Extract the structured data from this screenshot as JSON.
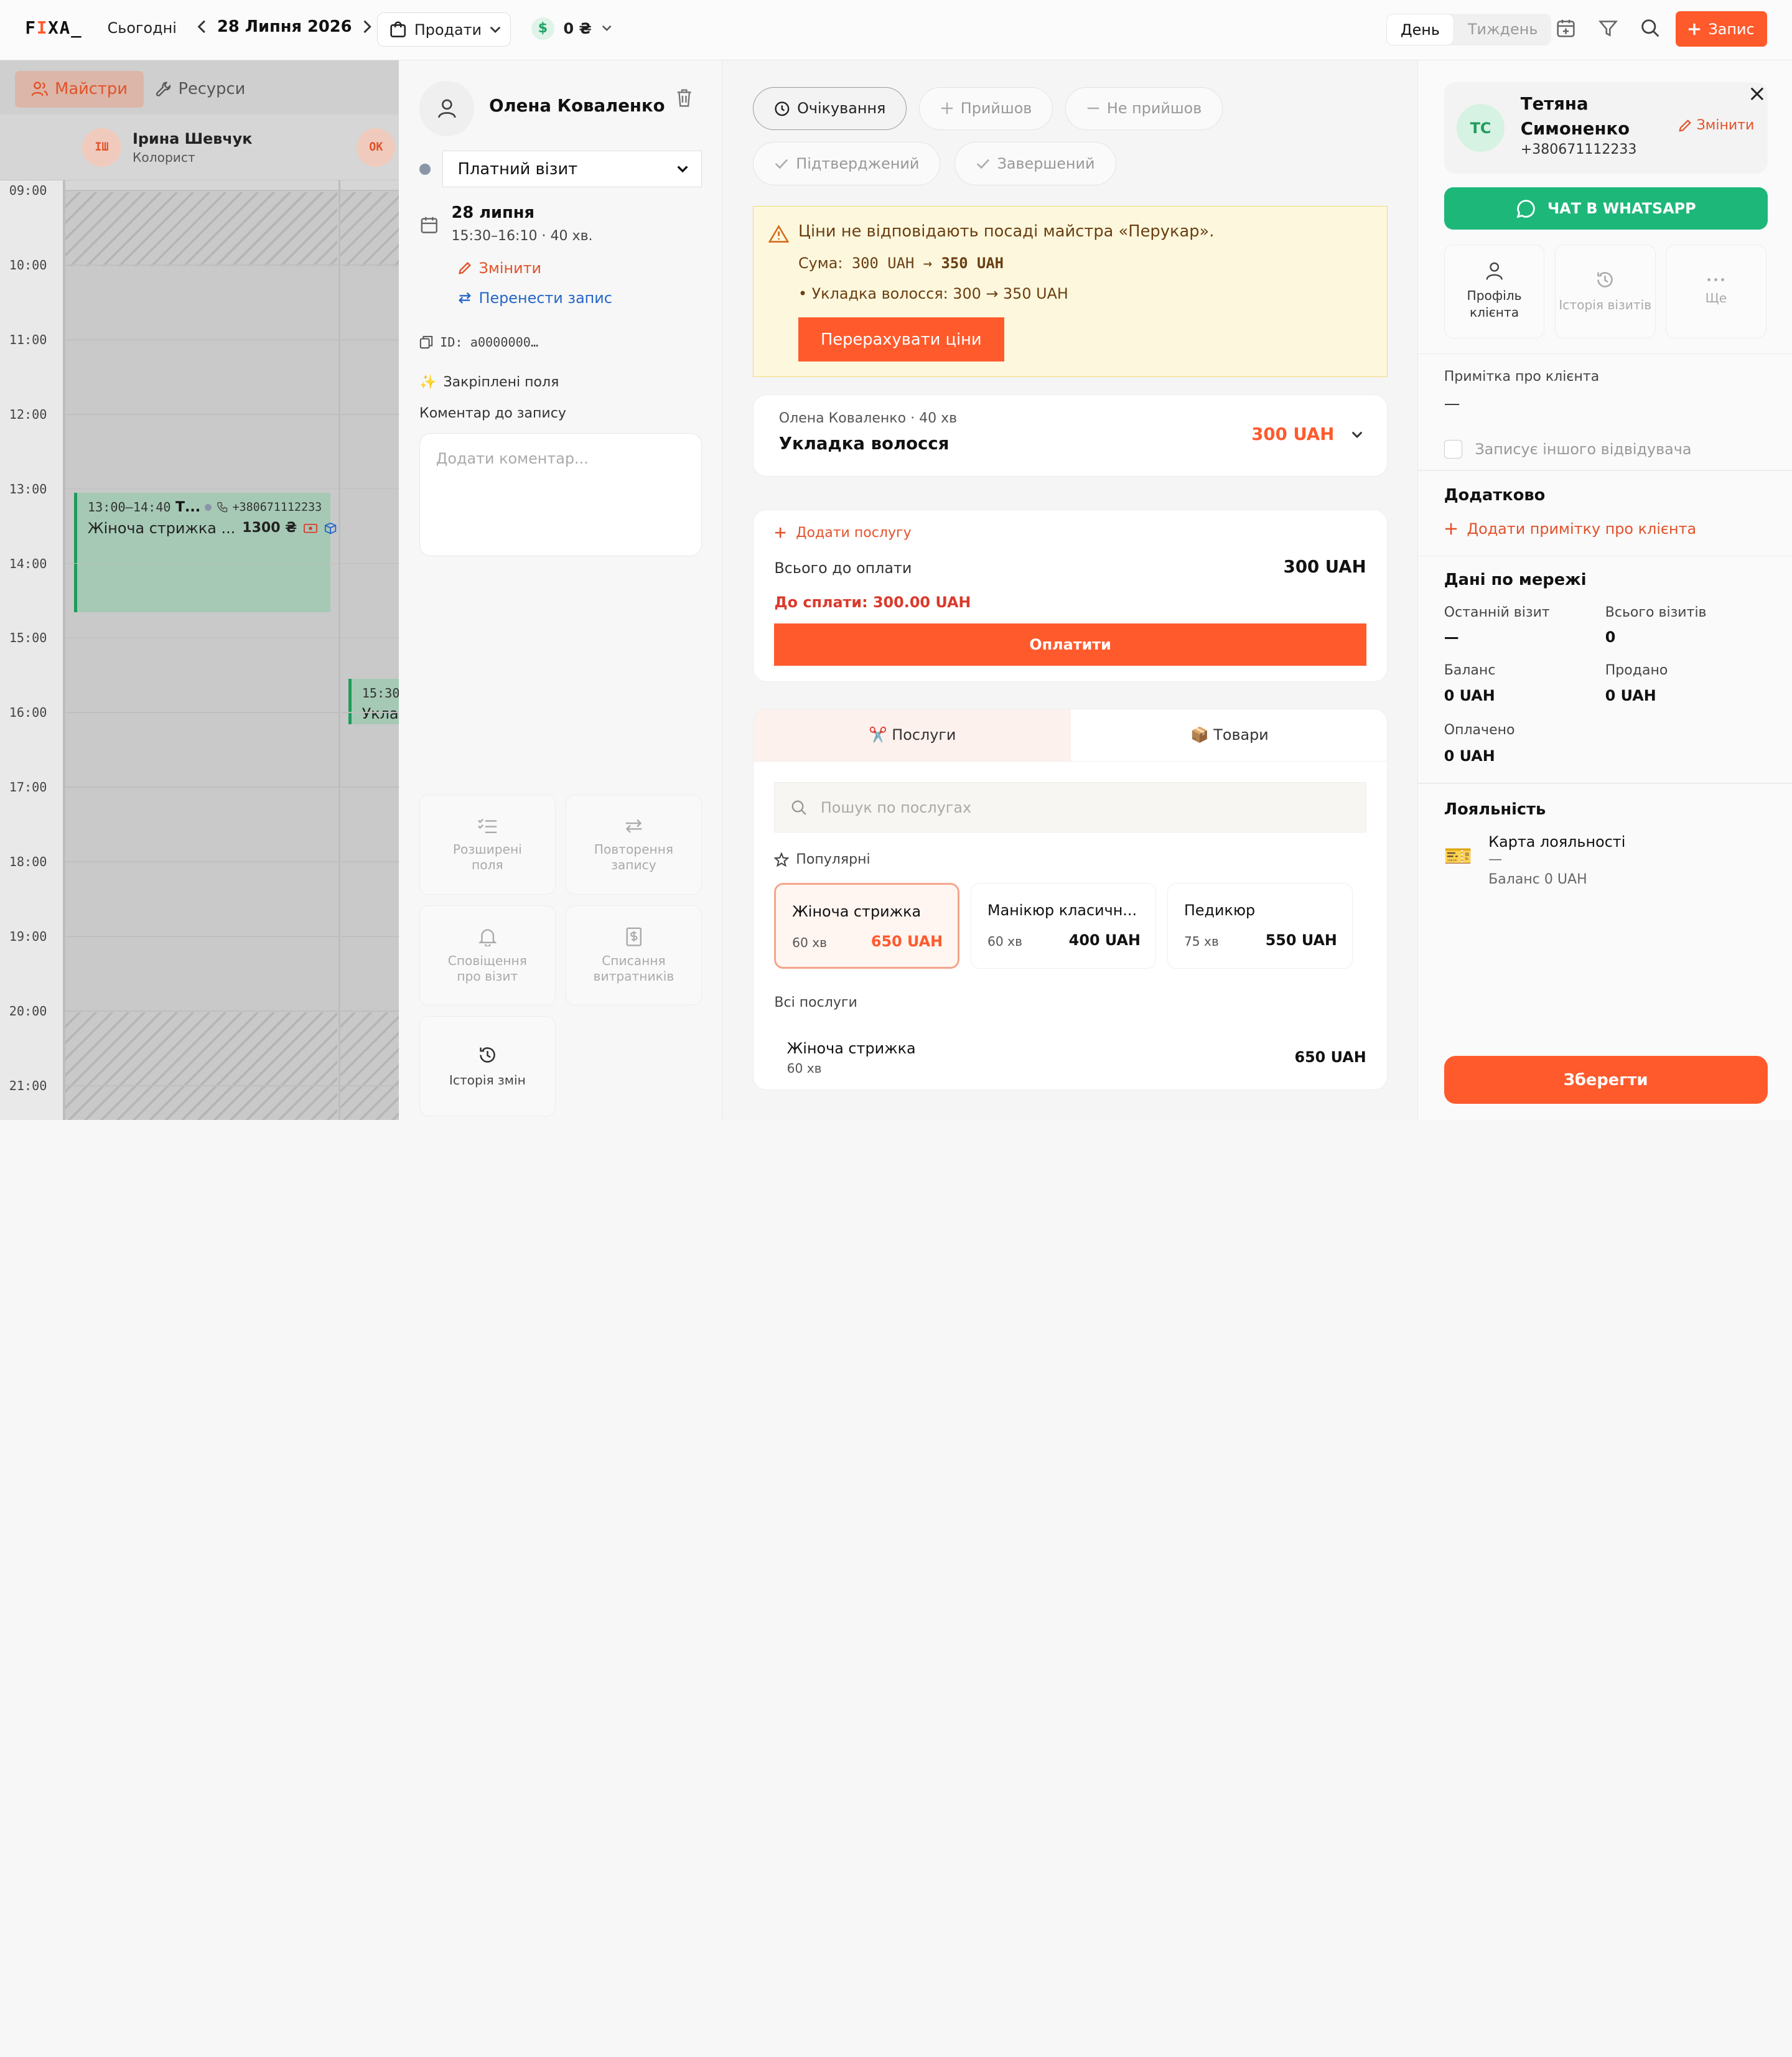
{
  "header": {
    "logo": "FIXA_",
    "today": "Сьогодні",
    "date": "28 Липня 2026",
    "sell": "Продати",
    "cash": "0 ₴",
    "cash_icon": "$",
    "view_day": "День",
    "view_week": "Тиждень",
    "new_record": "Запис"
  },
  "calendar": {
    "tab_masters": "Майстри",
    "tab_resources": "Ресурси",
    "masters": [
      {
        "initials": "ІШ",
        "name": "Ірина Шевчук",
        "role": "Колорист"
      },
      {
        "initials": "ОК",
        "name": "",
        "role": ""
      }
    ],
    "times": [
      "09:00",
      "10:00",
      "11:00",
      "12:00",
      "13:00",
      "14:00",
      "15:00",
      "16:00",
      "17:00",
      "18:00",
      "19:00",
      "20:00",
      "21:00"
    ],
    "appt1": {
      "time": "13:00–14:40",
      "client": "Т...",
      "phone": "+380671112233",
      "service": "Жіноча стрижка ...",
      "price": "1300 ₴"
    },
    "appt2": {
      "time": "15:30",
      "service": "Уклад"
    }
  },
  "visit": {
    "client_name": "Олена Коваленко",
    "visit_type": "Платний візит",
    "date": "28 липня",
    "time": "15:30–16:10 · 40 хв.",
    "edit": "Змінити",
    "move": "Перенести запис",
    "id": "ID: a0000000…",
    "pinned_icon": "✨",
    "pinned": "Закріплені поля",
    "comment_label": "Коментар до запису",
    "comment_placeholder": "Додати коментар...",
    "tiles": [
      "Розширені поля",
      "Повторення запису",
      "Сповіщення про візит",
      "Списання витратників",
      "Історія змін"
    ]
  },
  "main": {
    "statuses": [
      "Очікування",
      "Прийшов",
      "Не прийшов",
      "Підтверджений",
      "Завершений"
    ],
    "warning": {
      "title": "Ціни не відповідають посаді майстра «Перукар».",
      "sum_prefix": "Сума:",
      "sum_old": "300 UAH",
      "arrow": "→",
      "sum_new": "350 UAH",
      "detail": "• Укладка волосся: 300 → 350 UAH",
      "button": "Перерахувати ціни"
    },
    "service": {
      "meta": "Олена Коваленко · 40 хв",
      "name": "Укладка волосся",
      "price": "300 UAH"
    },
    "payment": {
      "add": "Додати послугу",
      "total_label": "Всього до оплати",
      "total": "300 UAH",
      "due": "До сплати: 300.00 UAH",
      "pay": "Оплатити"
    },
    "catalog": {
      "tab_services": "✂️ Послуги",
      "tab_goods": "📦 Товари",
      "search": "Пошук по послугах",
      "popular": "Популярні",
      "popular_items": [
        {
          "name": "Жіноча стрижка",
          "dur": "60 хв",
          "price": "650 UAH"
        },
        {
          "name": "Манікюр класичн...",
          "dur": "60 хв",
          "price": "400 UAH"
        },
        {
          "name": "Педикюр",
          "dur": "75 хв",
          "price": "550 UAH"
        }
      ],
      "all": "Всі послуги",
      "all_item": {
        "name": "Жіноча стрижка",
        "dur": "60 хв",
        "price": "650 UAH"
      }
    }
  },
  "client": {
    "initials": "ТС",
    "name": "Тетяна Симоненко",
    "phone": "+380671112233",
    "edit": "Змінити",
    "whatsapp": "ЧАТ В WHATSAPP",
    "quick": [
      "Профіль клієнта",
      "Історія візитів",
      "Ще"
    ],
    "note_label": "Примітка про клієнта",
    "note": "—",
    "other_visitor": "Записує іншого відвідувача",
    "extra": "Додатково",
    "add_note": "Додати примітку про клієнта",
    "network": "Дані по мережі",
    "last_visit_l": "Останній візит",
    "last_visit": "—",
    "total_visits_l": "Всього візитів",
    "total_visits": "0",
    "balance_l": "Баланс",
    "balance": "0 UAH",
    "sold_l": "Продано",
    "sold": "0 UAH",
    "paid_l": "Оплачено",
    "paid": "0 UAH",
    "loyalty": "Лояльність",
    "loyalty_icon": "🎫",
    "loyalty_card": "Карта лояльності",
    "loyalty_dash": "—",
    "loyalty_balance": "Баланс 0 UAH",
    "save": "Зберегти"
  },
  "colors": {
    "accent": "#ff5a2c",
    "whatsapp": "#1eb77a",
    "appointment": "#a6c9b5"
  }
}
